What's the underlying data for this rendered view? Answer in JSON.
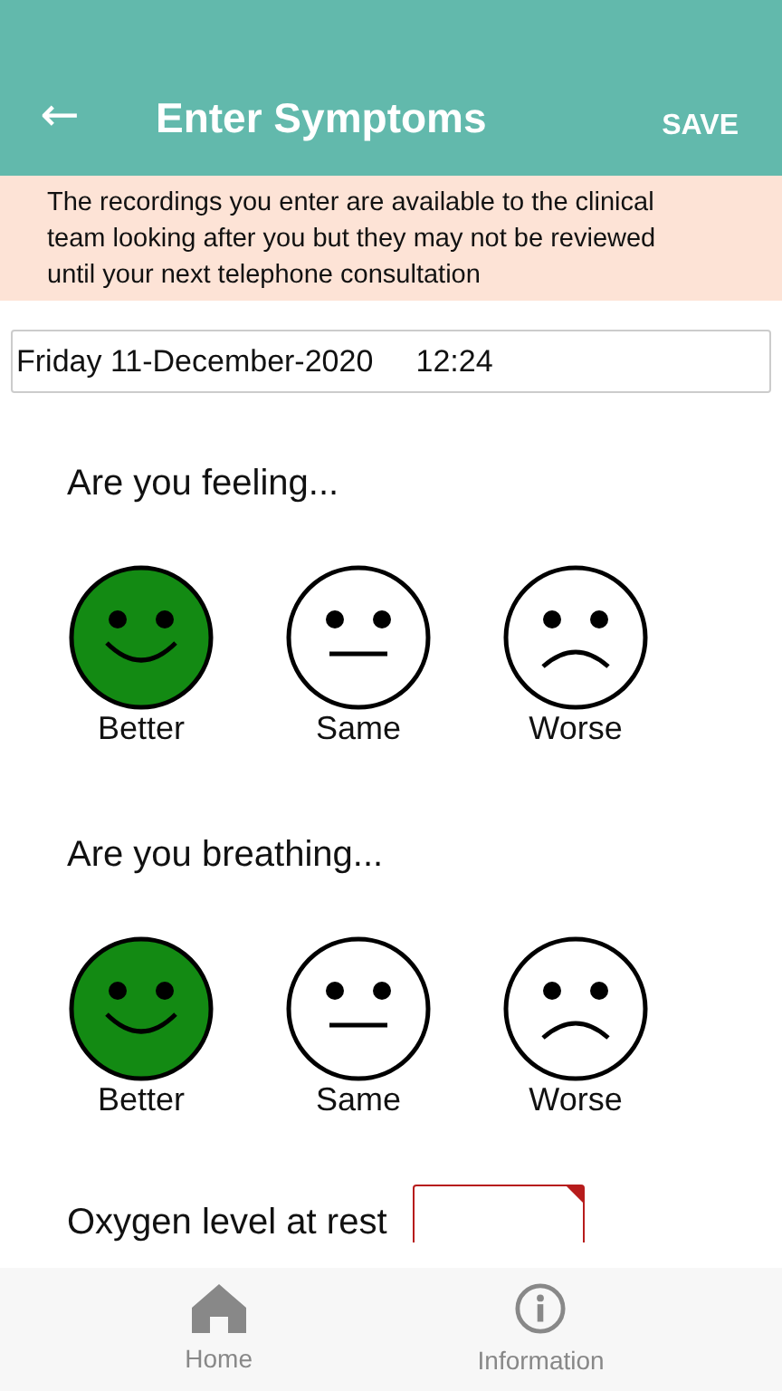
{
  "header": {
    "back_icon": "←",
    "title": "Enter Symptoms",
    "action": "SAVE"
  },
  "notice": "The recordings you enter are available to the clinical team looking after you but they may not be reviewed until your next telephone consultation",
  "date_field": {
    "value": "Friday 11-December-2020     12:24"
  },
  "questions": [
    {
      "prompt": "Are you feeling...",
      "options": [
        {
          "kind": "happy",
          "label": "Better",
          "selected": true
        },
        {
          "kind": "neutral",
          "label": "Same",
          "selected": false
        },
        {
          "kind": "sad",
          "label": "Worse",
          "selected": false
        }
      ]
    },
    {
      "prompt": "Are you breathing...",
      "options": [
        {
          "kind": "happy",
          "label": "Better",
          "selected": true
        },
        {
          "kind": "neutral",
          "label": "Same",
          "selected": false
        },
        {
          "kind": "sad",
          "label": "Worse",
          "selected": false
        }
      ]
    }
  ],
  "oxygen": {
    "label": "Oxygen level at rest",
    "required": true
  },
  "nav": [
    {
      "kind": "home",
      "label": "Home",
      "selected": false
    },
    {
      "kind": "info",
      "label": "Information",
      "selected": false
    }
  ]
}
